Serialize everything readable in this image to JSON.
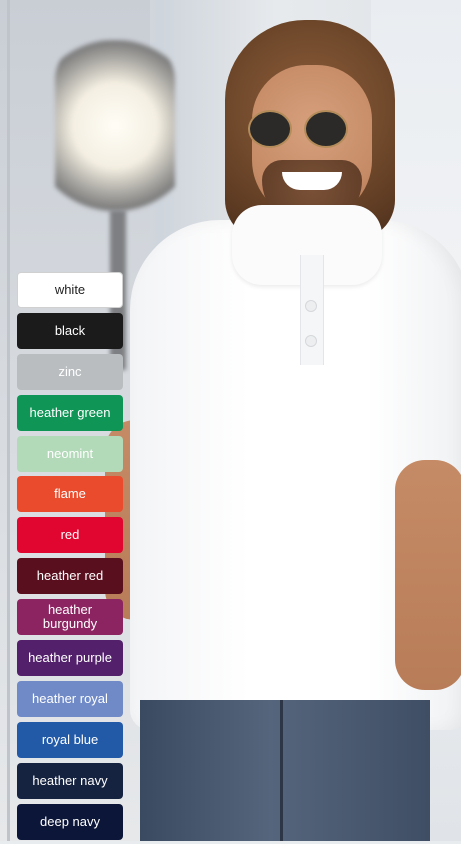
{
  "colors": [
    {
      "label": "white",
      "bg": "#ffffff",
      "fg": "#222222"
    },
    {
      "label": "black",
      "bg": "#1b1b1b",
      "fg": "#ffffff"
    },
    {
      "label": "zinc",
      "bg": "#b9bdbf",
      "fg": "#ffffff"
    },
    {
      "label": "heather green",
      "bg": "#0f9556",
      "fg": "#ffffff"
    },
    {
      "label": "neomint",
      "bg": "#b2d9b8",
      "fg": "#ffffff"
    },
    {
      "label": "flame",
      "bg": "#ea4b2c",
      "fg": "#ffffff"
    },
    {
      "label": "red",
      "bg": "#e1062f",
      "fg": "#ffffff"
    },
    {
      "label": "heather red",
      "bg": "#5a0f1e",
      "fg": "#ffffff"
    },
    {
      "label": "heather burgundy",
      "bg": "#8c2461",
      "fg": "#ffffff"
    },
    {
      "label": "heather purple",
      "bg": "#53206b",
      "fg": "#ffffff"
    },
    {
      "label": "heather royal",
      "bg": "#6f8ac7",
      "fg": "#ffffff"
    },
    {
      "label": "royal blue",
      "bg": "#235aa8",
      "fg": "#ffffff"
    },
    {
      "label": "heather navy",
      "bg": "#162340",
      "fg": "#ffffff"
    },
    {
      "label": "deep navy",
      "bg": "#0b1638",
      "fg": "#ffffff"
    }
  ]
}
